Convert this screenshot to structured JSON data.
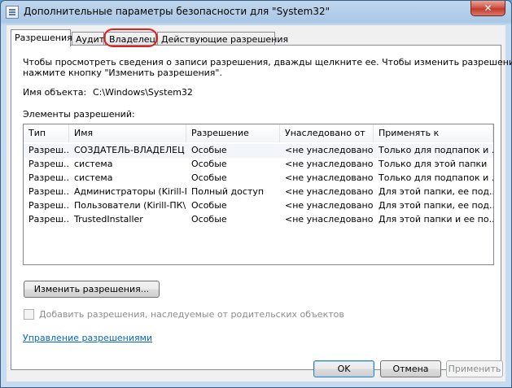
{
  "window": {
    "title": "Дополнительные параметры безопасности  для \"System32\"",
    "close_glyph": "✕"
  },
  "tabs": [
    {
      "label": "Разрешения"
    },
    {
      "label": "Аудит"
    },
    {
      "label": "Владелец"
    },
    {
      "label": "Действующие разрешения"
    }
  ],
  "permissions": {
    "info_line1": "Чтобы просмотреть сведения о записи разрешения, дважды щелкните ее. Чтобы изменить разрешения,",
    "info_line2": "нажмите кнопку \"Изменить разрешения\".",
    "object_label": "Имя объекта:",
    "object_value": "C:\\Windows\\System32",
    "entries_label": "Элементы разрешений:",
    "columns": [
      "Тип",
      "Имя",
      "Разрешение",
      "Унаследовано от",
      "Применять к"
    ],
    "rows": [
      [
        "Разреш...",
        "СОЗДАТЕЛЬ-ВЛАДЕЛЕЦ",
        "Особые",
        "<не унаследовано>",
        "Только для подпапок и ..."
      ],
      [
        "Разреш...",
        "система",
        "Особые",
        "<не унаследовано>",
        "Только для этой папки"
      ],
      [
        "Разреш...",
        "система",
        "Особые",
        "<не унаследовано>",
        "Только для подпапок и ..."
      ],
      [
        "Разреш...",
        "Администраторы (Kirill-П...",
        "Полный доступ",
        "<не унаследовано>",
        "Для этой папки, ее под..."
      ],
      [
        "Разреш...",
        "Пользователи (Kirill-ПК\\...",
        "Особые",
        "<не унаследовано>",
        "Для этой папки, ее под..."
      ],
      [
        "Разреш...",
        "TrustedInstaller",
        "Особые",
        "<не унаследовано>",
        "Для этой папки и ее по..."
      ]
    ],
    "change_button": "Изменить разрешения...",
    "inherit_checkbox": "Добавить разрешения, наследуемые от родительских объектов",
    "manage_link": "Управление разрешениями"
  },
  "buttons": {
    "ok": "OK",
    "cancel": "Отмена",
    "apply": "Применить"
  },
  "colors": {
    "annotation": "#e0201b",
    "link": "#0066cc"
  }
}
